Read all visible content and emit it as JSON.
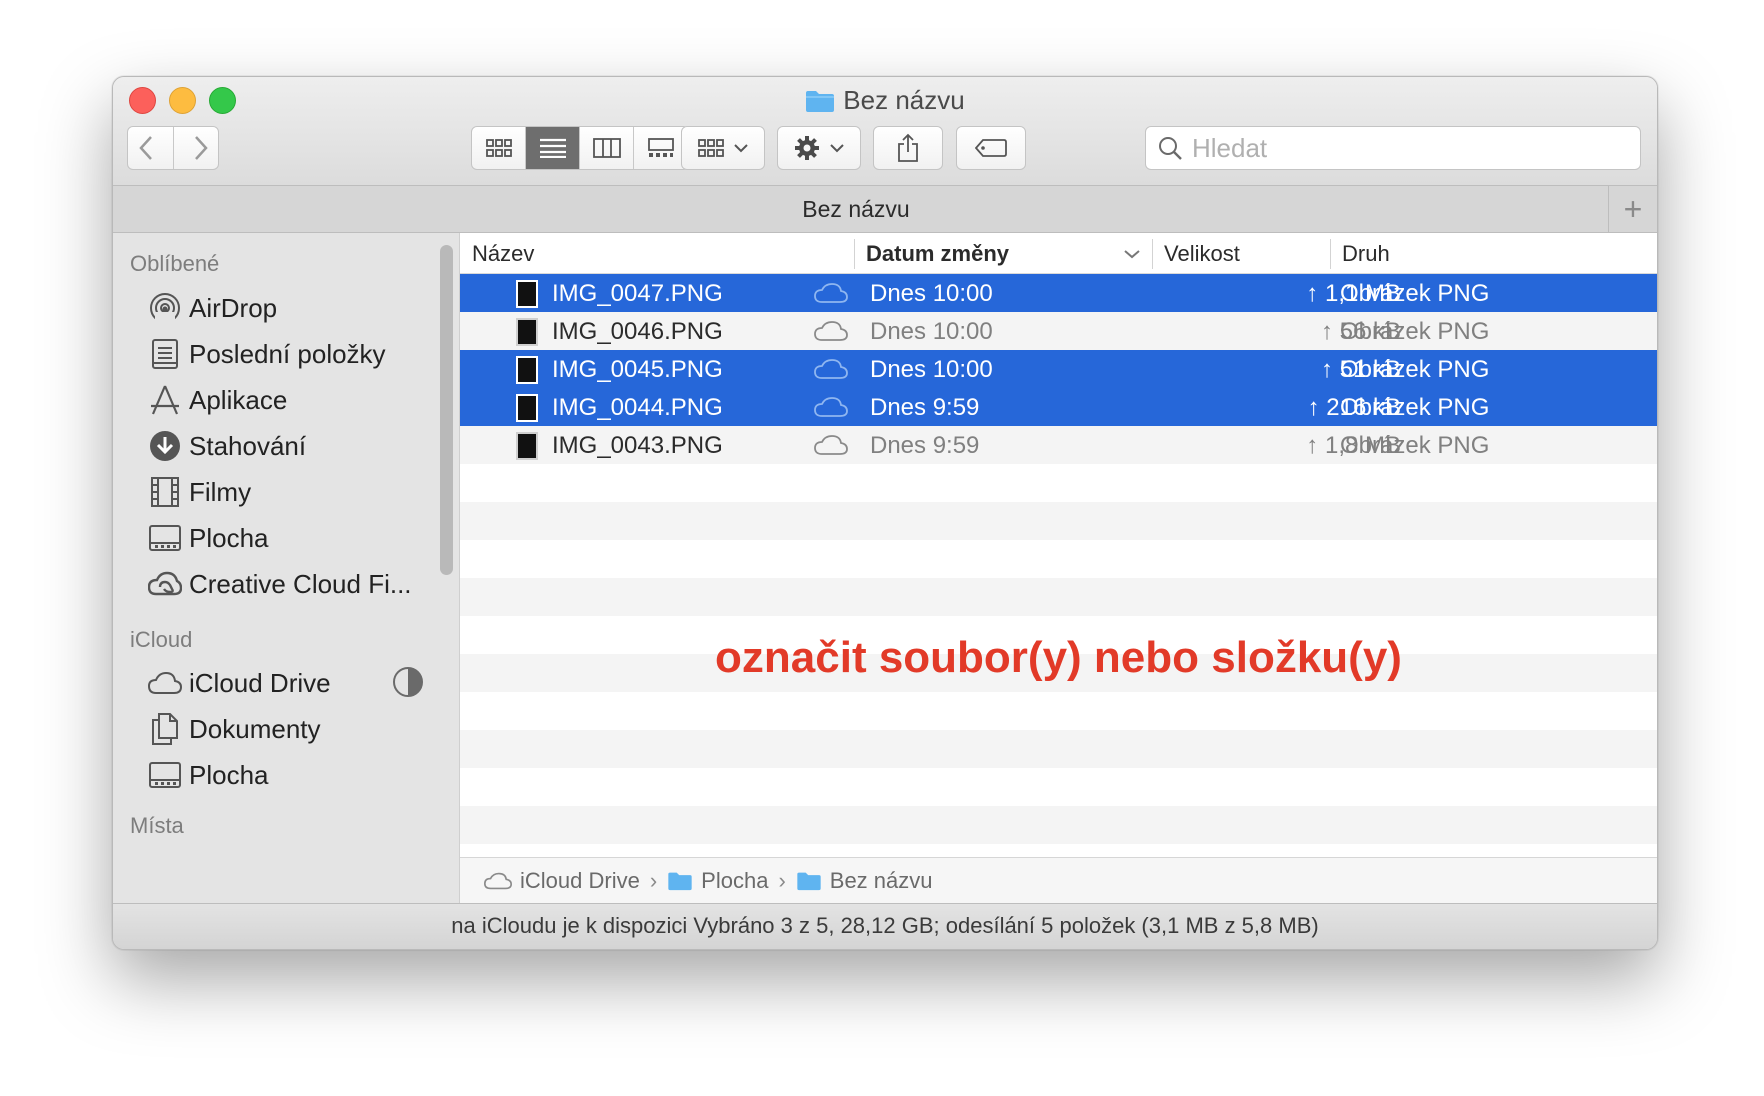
{
  "window": {
    "title": "Bez názvu"
  },
  "toolbar": {
    "search_placeholder": "Hledat"
  },
  "tab": {
    "title": "Bez názvu",
    "plus": "+"
  },
  "sidebar": {
    "favorites_header": "Oblíbené",
    "favorites": [
      {
        "label": "AirDrop",
        "icon": "airdrop-icon"
      },
      {
        "label": "Poslední položky",
        "icon": "recents-icon"
      },
      {
        "label": "Aplikace",
        "icon": "applications-icon"
      },
      {
        "label": "Stahování",
        "icon": "downloads-icon"
      },
      {
        "label": "Filmy",
        "icon": "movies-icon"
      },
      {
        "label": "Plocha",
        "icon": "desktop-icon"
      },
      {
        "label": "Creative Cloud Fi...",
        "icon": "creative-cloud-icon"
      }
    ],
    "icloud_header": "iCloud",
    "icloud": [
      {
        "label": "iCloud Drive",
        "icon": "cloud-icon"
      },
      {
        "label": "Dokumenty",
        "icon": "documents-icon"
      },
      {
        "label": "Plocha",
        "icon": "desktop-icon"
      }
    ],
    "places_header": "Místa"
  },
  "columns": {
    "name": "Název",
    "date": "Datum změny",
    "size": "Velikost",
    "kind": "Druh"
  },
  "files": [
    {
      "name": "IMG_0047.PNG",
      "date": "Dnes 10:00",
      "size": "↑ 1,1 MB",
      "kind": "Obrázek PNG",
      "selected": true
    },
    {
      "name": "IMG_0046.PNG",
      "date": "Dnes 10:00",
      "size": "↑ 56 kB",
      "kind": "Obrázek PNG",
      "selected": false
    },
    {
      "name": "IMG_0045.PNG",
      "date": "Dnes 10:00",
      "size": "↑ 51 kB",
      "kind": "Obrázek PNG",
      "selected": true
    },
    {
      "name": "IMG_0044.PNG",
      "date": "Dnes 9:59",
      "size": "↑ 216 kB",
      "kind": "Obrázek PNG",
      "selected": true
    },
    {
      "name": "IMG_0043.PNG",
      "date": "Dnes 9:59",
      "size": "↑ 1,8 MB",
      "kind": "Obrázek PNG",
      "selected": false
    }
  ],
  "annotation": "označit soubor(y) nebo složku(y)",
  "pathbar": [
    "iCloud Drive",
    "Plocha",
    "Bez názvu"
  ],
  "statusbar": "na iCloudu je k dispozici Vybráno 3 z 5, 28,12 GB; odesílání 5 položek (3,1 MB z 5,8 MB)",
  "colors": {
    "selection": "#2667d9",
    "annotation": "#e23a28",
    "folder": "#5fb4f0"
  }
}
